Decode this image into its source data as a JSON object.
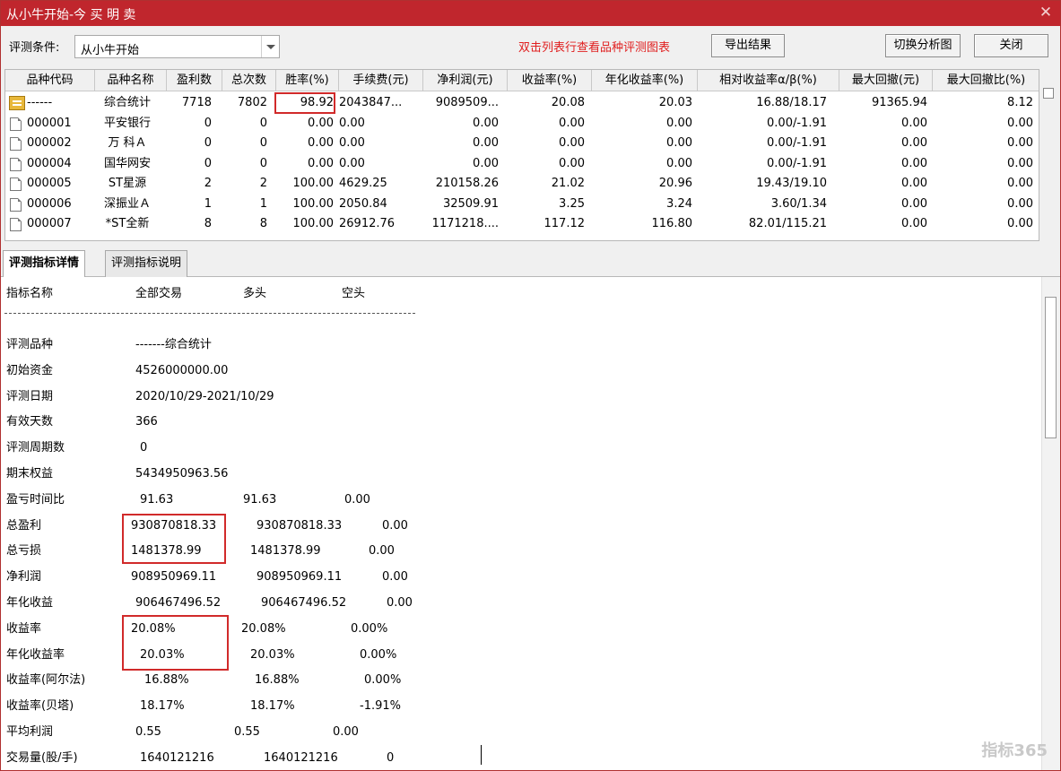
{
  "window": {
    "title": "从小牛开始-今 买 明 卖"
  },
  "toolbar": {
    "condition_label": "评测条件:",
    "condition_value": "从小牛开始",
    "hint": "双击列表行查看品种评测图表",
    "export_button": "导出结果",
    "switch_button": "切换分析图",
    "close_button": "关闭"
  },
  "grid": {
    "headers": [
      "品种代码",
      "品种名称",
      "盈利数",
      "总次数",
      "胜率(%)",
      "手续费(元)",
      "净利润(元)",
      "收益率(%)",
      "年化收益率(%)",
      "相对收益率α/β(%)",
      "最大回撤(元)",
      "最大回撤比(%)"
    ],
    "rows": [
      [
        "------",
        "综合统计",
        "7718",
        "7802",
        "98.92",
        "2043847...",
        "9089509...",
        "20.08",
        "20.03",
        "16.88/18.17",
        "91365.94",
        "8.12"
      ],
      [
        "000001",
        "平安银行",
        "0",
        "0",
        "0.00",
        "0.00",
        "0.00",
        "0.00",
        "0.00",
        "0.00/-1.91",
        "0.00",
        "0.00"
      ],
      [
        "000002",
        "万 科Ａ",
        "0",
        "0",
        "0.00",
        "0.00",
        "0.00",
        "0.00",
        "0.00",
        "0.00/-1.91",
        "0.00",
        "0.00"
      ],
      [
        "000004",
        "国华网安",
        "0",
        "0",
        "0.00",
        "0.00",
        "0.00",
        "0.00",
        "0.00",
        "0.00/-1.91",
        "0.00",
        "0.00"
      ],
      [
        "000005",
        "ST星源",
        "2",
        "2",
        "100.00",
        "4629.25",
        "210158.26",
        "21.02",
        "20.96",
        "19.43/19.10",
        "0.00",
        "0.00"
      ],
      [
        "000006",
        "深振业Ａ",
        "1",
        "1",
        "100.00",
        "2050.84",
        "32509.91",
        "3.25",
        "3.24",
        "3.60/1.34",
        "0.00",
        "0.00"
      ],
      [
        "000007",
        "*ST全新",
        "8",
        "8",
        "100.00",
        "26912.76",
        "1171218....",
        "117.12",
        "116.80",
        "82.01/115.21",
        "0.00",
        "0.00"
      ]
    ]
  },
  "tabs": [
    "评测指标详情",
    "评测指标说明"
  ],
  "detail": {
    "header": [
      "指标名称",
      "全部交易",
      "多头",
      "空头"
    ],
    "separator": "--------------------------------------------------------------------------------",
    "rows": [
      [
        "评测品种",
        "-------综合统计",
        "",
        ""
      ],
      [
        "初始资金",
        "4526000000.00",
        "",
        ""
      ],
      [
        "评测日期",
        "2020/10/29-2021/10/29",
        "",
        ""
      ],
      [
        "有效天数",
        "366",
        "",
        ""
      ],
      [
        "评测周期数",
        "0",
        "",
        ""
      ],
      [
        "期末权益",
        "5434950963.56",
        "",
        ""
      ],
      [
        "盈亏时间比",
        "91.63",
        "91.63",
        "0.00"
      ],
      [
        "总盈利",
        "930870818.33",
        "930870818.33",
        "0.00"
      ],
      [
        "总亏损",
        "1481378.99",
        "1481378.99",
        "0.00"
      ],
      [
        "净利润",
        "908950969.11",
        "908950969.11",
        "0.00"
      ],
      [
        "年化收益",
        "906467496.52",
        "906467496.52",
        "0.00"
      ],
      [
        "收益率",
        "20.08%",
        "20.08%",
        "0.00%"
      ],
      [
        "年化收益率",
        "20.03%",
        "20.03%",
        "0.00%"
      ],
      [
        "收益率(阿尔法)",
        "16.88%",
        "16.88%",
        "0.00%"
      ],
      [
        "收益率(贝塔)",
        "18.17%",
        "18.17%",
        "-1.91%"
      ],
      [
        "平均利润",
        "0.55",
        "0.55",
        "0.00"
      ],
      [
        "交易量(股/手)",
        "1640121216",
        "1640121216",
        "0"
      ]
    ]
  },
  "watermark": "指标365",
  "colors": {
    "title_bar": "#c0262d",
    "highlight": "#d12a2a",
    "hint_text": "#e02020"
  }
}
